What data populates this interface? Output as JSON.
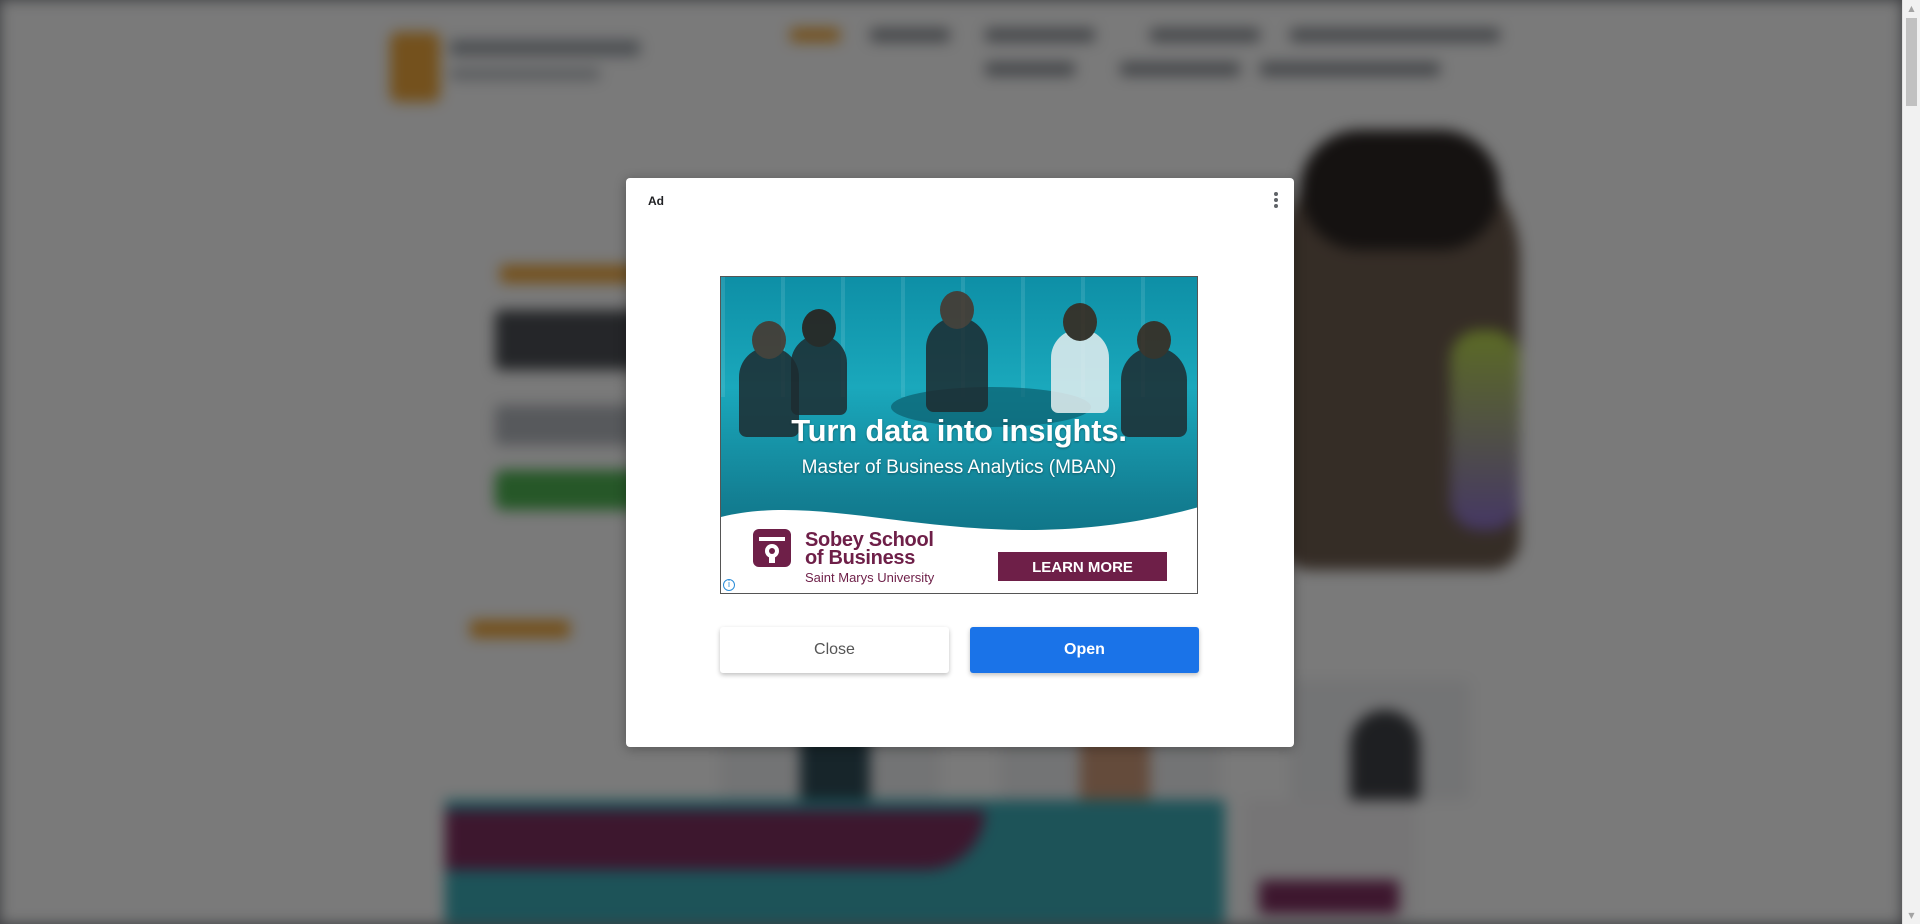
{
  "dialog": {
    "ad_label": "Ad",
    "menu_icon": "more-vert-icon",
    "close_label": "Close",
    "open_label": "Open"
  },
  "creative": {
    "headline": "Turn data into insights.",
    "subhead": "Master of Business Analytics (MBAN)",
    "school_line1": "Sobey School",
    "school_line2": "of Business",
    "university": "Saint Marys University",
    "cta": "LEARN MORE",
    "adchoices_icon": "info-icon",
    "brand_color": "#6e1f48",
    "teal_color": "#1aa8bc"
  },
  "colors": {
    "open_button": "#1a73e8",
    "overlay": "rgba(0,0,0,0.5)"
  }
}
